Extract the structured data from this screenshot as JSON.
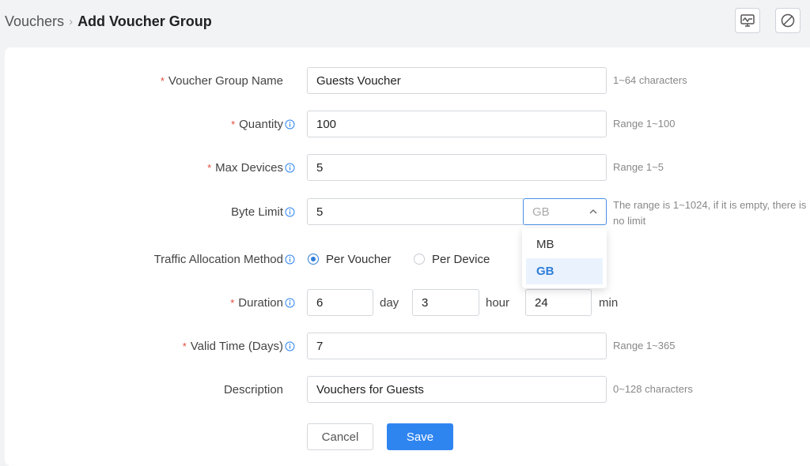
{
  "breadcrumb": {
    "parent": "Vouchers",
    "separator": "›",
    "current": "Add Voucher Group"
  },
  "toolbar": {
    "icons": [
      "monitor-chart-icon",
      "no-sign-icon"
    ]
  },
  "form": {
    "group_name": {
      "label": "Voucher Group Name",
      "required": true,
      "value": "Guests Voucher",
      "hint": "1~64 characters"
    },
    "quantity": {
      "label": "Quantity",
      "required": true,
      "value": "100",
      "hint": "Range 1~100"
    },
    "max_devices": {
      "label": "Max Devices",
      "required": true,
      "value": "5",
      "hint": "Range 1~5"
    },
    "byte_limit": {
      "label": "Byte Limit",
      "required": false,
      "value": "5",
      "unit_selected": "GB",
      "unit_options": [
        "MB",
        "GB"
      ],
      "hint_line1": "The range is 1~1024, if it is empty, there is",
      "hint_line2": "no limit"
    },
    "traffic_allocation": {
      "label": "Traffic Allocation Method",
      "options": [
        "Per Voucher",
        "Per Device"
      ],
      "selected": "Per Voucher"
    },
    "duration": {
      "label": "Duration",
      "required": true,
      "day": "6",
      "day_unit": "day",
      "hour": "3",
      "hour_unit": "hour",
      "min": "24",
      "min_unit": "min"
    },
    "valid_time": {
      "label": "Valid Time (Days)",
      "required": true,
      "value": "7",
      "hint": "Range 1~365"
    },
    "description": {
      "label": "Description",
      "required": false,
      "value": "Vouchers for Guests",
      "hint": "0~128 characters"
    }
  },
  "actions": {
    "cancel_label": "Cancel",
    "save_label": "Save"
  },
  "colors": {
    "accent": "#2f85f0",
    "required": "#e04a3a",
    "panel_bg": "#ffffff",
    "page_bg": "#f2f3f5"
  }
}
